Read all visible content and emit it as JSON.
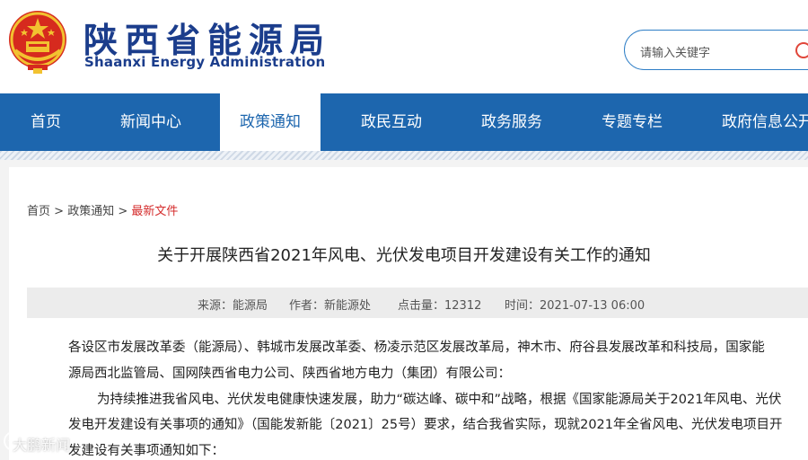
{
  "header": {
    "site_title_cn": "陕西省能源局",
    "site_title_en": "Shaanxi Energy Administration"
  },
  "search": {
    "placeholder": "请输入关键字"
  },
  "nav": {
    "items": [
      "首页",
      "新闻中心",
      "政策通知",
      "政民互动",
      "政务服务",
      "专题专栏",
      "政府信息公开"
    ],
    "active": "政策通知"
  },
  "breadcrumb": {
    "home": "首页",
    "sep1": " > ",
    "section": "政策通知",
    "sep2": " > ",
    "current": "最新文件"
  },
  "article": {
    "title": "关于开展陕西省2021年风电、光伏发电项目开发建设有关工作的通知",
    "meta": {
      "source": "来源：能源局",
      "author": "作者：新能源处",
      "clicks": "点击量：12312",
      "time": "时间：2021-07-13 06:00"
    },
    "paragraphs": [
      "各设区市发展改革委（能源局）、韩城市发展改革委、杨凌示范区发展改革局，神木市、府谷县发展改革和科技局，国家能",
      "源局西北监管局、国网陕西省电力公司、陕西省地方电力（集团）有限公司：",
      "为持续推进我省风电、光伏发电健康快速发展，助力“碳达峰、碳中和”战略，根据《国家能源局关于2021年风电、光伏",
      "发电开发建设有关事项的通知》（国能发新能〔2021〕25号）要求，结合我省实际，现就2021年全省风电、光伏发电项目开",
      "发建设有关事项通知如下："
    ]
  },
  "watermark": {
    "text": "大鹏新闻"
  },
  "colors": {
    "nav_blue": "#1d66ae",
    "title_blue": "#1b3d8c",
    "breadcrumb_current": "#d42b2b"
  }
}
